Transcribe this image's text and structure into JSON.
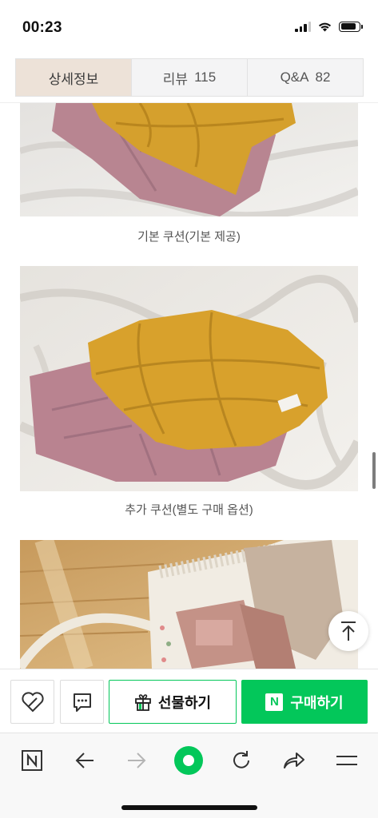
{
  "status_bar": {
    "time": "00:23",
    "battery_level": 0.85
  },
  "tabs": [
    {
      "label": "상세정보",
      "count": ""
    },
    {
      "label": "리뷰",
      "count": "115"
    },
    {
      "label": "Q&A",
      "count": "82"
    }
  ],
  "content": {
    "captions": [
      "기본 쿠션(기본 제공)",
      "추가 쿠션(별도 구매 옵션)"
    ]
  },
  "actions": {
    "gift_label": "선물하기",
    "buy_label": "구매하기",
    "buy_badge": "N"
  },
  "browser": {
    "items": [
      "naver-logo",
      "back",
      "forward",
      "home",
      "refresh",
      "share",
      "menu"
    ]
  },
  "colors": {
    "accent_green": "#03c75a",
    "active_tab": "#ede2d8",
    "cushion_mustard": "#d9a22c",
    "cushion_pink": "#b98390"
  }
}
